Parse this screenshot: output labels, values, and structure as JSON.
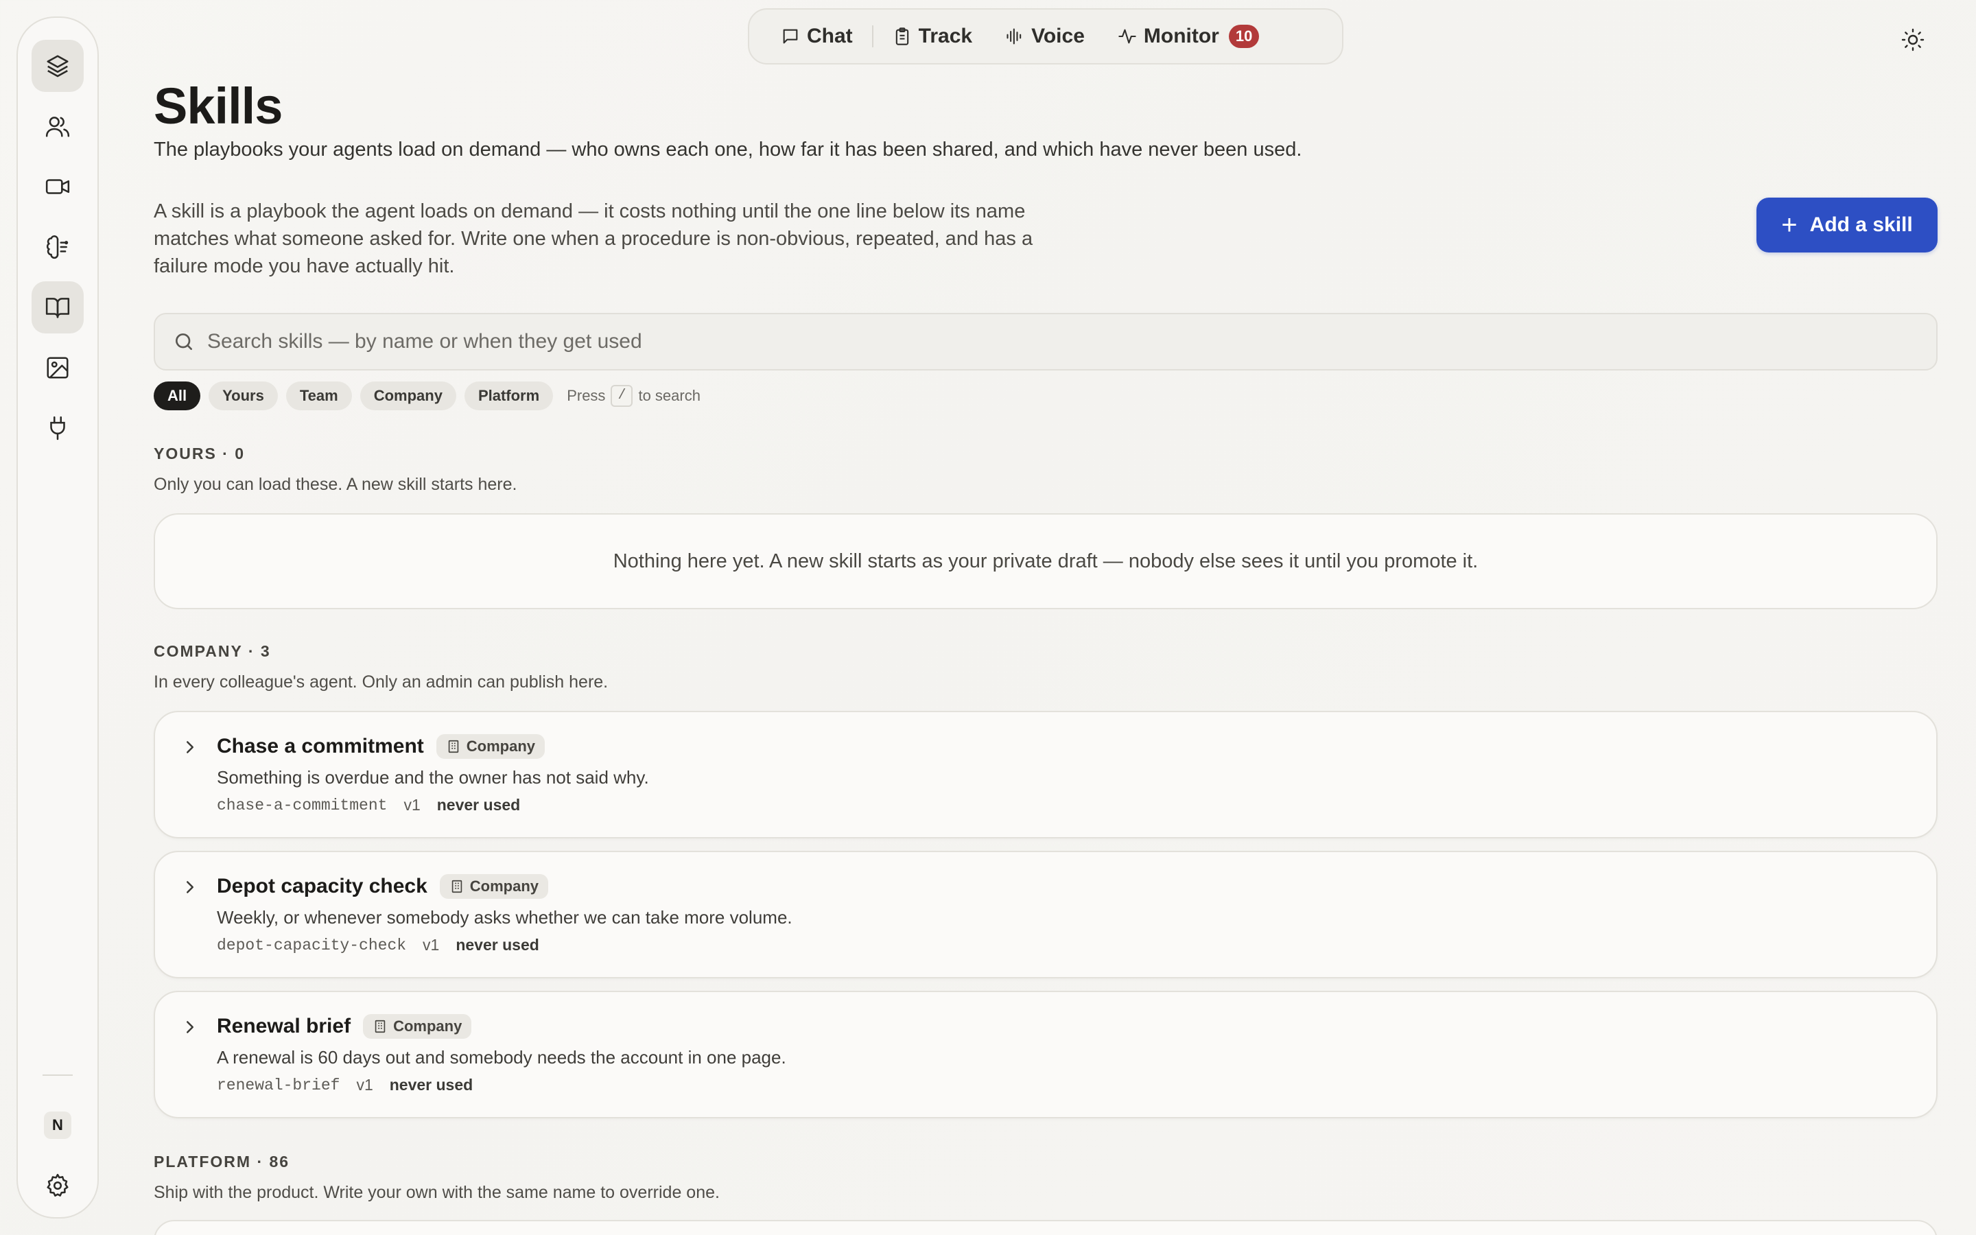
{
  "modes": [
    {
      "label": "Chat",
      "icon": "chat-bubble-icon"
    },
    {
      "label": "Track",
      "icon": "clipboard-icon"
    },
    {
      "label": "Voice",
      "icon": "waveform-icon"
    },
    {
      "label": "Monitor",
      "icon": "pulse-icon",
      "badge": "10"
    }
  ],
  "sidebar": {
    "items": [
      {
        "name": "layers",
        "icon": "layers-icon"
      },
      {
        "name": "people",
        "icon": "users-icon"
      },
      {
        "name": "video",
        "icon": "video-icon"
      },
      {
        "name": "brain",
        "icon": "brain-icon"
      },
      {
        "name": "skills",
        "icon": "book-icon",
        "active": true
      },
      {
        "name": "images",
        "icon": "image-icon"
      },
      {
        "name": "integrations",
        "icon": "plug-icon"
      }
    ],
    "avatar_initial": "N"
  },
  "page": {
    "title": "Skills",
    "subtitle": "The playbooks your agents load on demand — who owns each one, how far it has been shared, and which have never been used.",
    "intro": "A skill is a playbook the agent loads on demand — it costs nothing until the one line below its name matches what someone asked for. Write one when a procedure is non-obvious, repeated, and has a failure mode you have actually hit.",
    "add_button": "Add a skill"
  },
  "search": {
    "placeholder": "Search skills — by name or when they get used",
    "value": ""
  },
  "filters": {
    "chips": [
      "All",
      "Yours",
      "Team",
      "Company",
      "Platform"
    ],
    "active": "All",
    "hint_prefix": "Press",
    "hint_key": "/",
    "hint_suffix": "to search"
  },
  "sections": {
    "yours": {
      "heading": "YOURS · 0",
      "description": "Only you can load these. A new skill starts here.",
      "empty": "Nothing here yet. A new skill starts as your private draft — nobody else sees it until you promote it."
    },
    "company": {
      "heading": "COMPANY · 3",
      "description": "In every colleague's agent. Only an admin can publish here.",
      "skills": [
        {
          "name": "Chase a commitment",
          "tag": "Company",
          "description": "Something is overdue and the owner has not said why.",
          "slug": "chase-a-commitment",
          "version": "v1",
          "usage": "never used"
        },
        {
          "name": "Depot capacity check",
          "tag": "Company",
          "description": "Weekly, or whenever somebody asks whether we can take more volume.",
          "slug": "depot-capacity-check",
          "version": "v1",
          "usage": "never used"
        },
        {
          "name": "Renewal brief",
          "tag": "Company",
          "description": "A renewal is 60 days out and somebody needs the account in one page.",
          "slug": "renewal-brief",
          "version": "v1",
          "usage": "never used"
        }
      ]
    },
    "platform": {
      "heading": "PLATFORM · 86",
      "description": "Ship with the product. Write your own with the same name to override one."
    }
  },
  "colors": {
    "accent": "#2d4fc4",
    "badge": "#b23a3a",
    "background": "#f6f5f2"
  }
}
